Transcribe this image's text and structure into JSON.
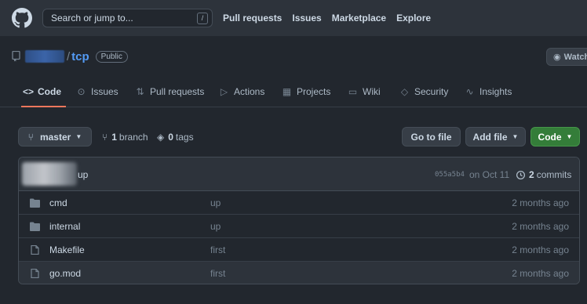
{
  "header": {
    "search_placeholder": "Search or jump to...",
    "search_shortcut": "/",
    "nav": [
      "Pull requests",
      "Issues",
      "Marketplace",
      "Explore"
    ]
  },
  "repo": {
    "separator": "/",
    "name": "tcp",
    "visibility": "Public",
    "watch_label": "Watch"
  },
  "tabs": [
    {
      "label": "Code",
      "icon": "code-icon",
      "active": true
    },
    {
      "label": "Issues",
      "icon": "issue-icon"
    },
    {
      "label": "Pull requests",
      "icon": "pull-request-icon"
    },
    {
      "label": "Actions",
      "icon": "play-icon"
    },
    {
      "label": "Projects",
      "icon": "table-icon"
    },
    {
      "label": "Wiki",
      "icon": "book-icon"
    },
    {
      "label": "Security",
      "icon": "shield-icon"
    },
    {
      "label": "Insights",
      "icon": "graph-icon"
    }
  ],
  "branch_bar": {
    "branch": "master",
    "branch_count": "1",
    "branch_word": "branch",
    "tag_count": "0",
    "tag_word": "tags",
    "go_to_file": "Go to file",
    "add_file": "Add file",
    "code": "Code"
  },
  "latest_commit": {
    "message": "up",
    "sha": "055a5b4",
    "date": "on Oct 11",
    "count": "2",
    "count_word": "commits"
  },
  "files": [
    {
      "type": "folder",
      "name": "cmd",
      "message": "up",
      "age": "2 months ago"
    },
    {
      "type": "folder",
      "name": "internal",
      "message": "up",
      "age": "2 months ago"
    },
    {
      "type": "file",
      "name": "Makefile",
      "message": "first",
      "age": "2 months ago"
    },
    {
      "type": "file",
      "name": "go.mod",
      "message": "first",
      "age": "2 months ago"
    }
  ],
  "colors": {
    "accent_link": "#539bf5",
    "tab_underline": "#ec775c",
    "code_button": "#347d39"
  }
}
